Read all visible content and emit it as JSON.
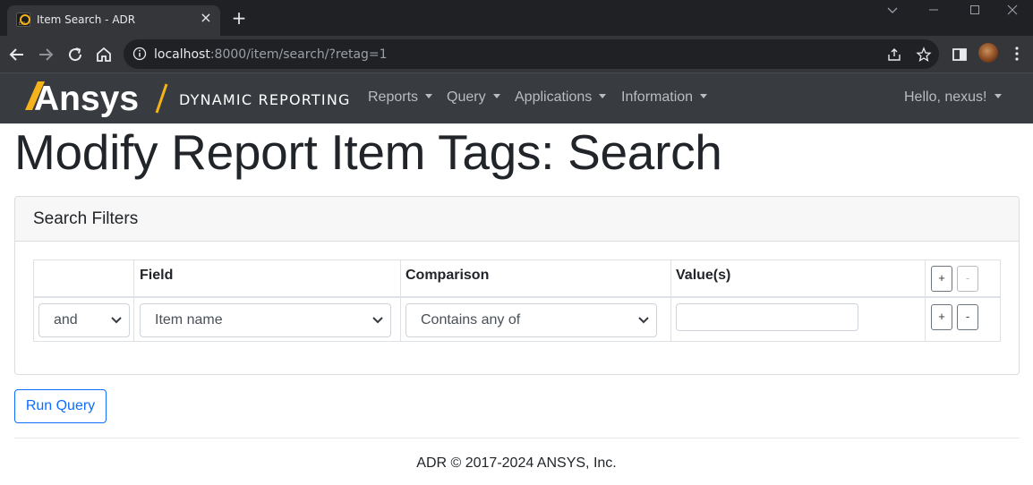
{
  "browser": {
    "tab_title": "Item Search - ADR",
    "favicon_text": "DR",
    "url_host": "localhost",
    "url_rest": ":8000/item/search/?retag=1"
  },
  "navbar": {
    "brand": "Ansys",
    "brand_subtitle": "DYNAMIC REPORTING",
    "brand_accent_color": "#f5b21b",
    "menus": [
      "Reports",
      "Query",
      "Applications",
      "Information"
    ],
    "user_greeting": "Hello, nexus!"
  },
  "page": {
    "title": "Modify Report Item Tags: Search"
  },
  "filters": {
    "card_title": "Search Filters",
    "columns": {
      "field": "Field",
      "comparison": "Comparison",
      "values": "Value(s)"
    },
    "add_label": "+",
    "remove_label": "-",
    "rows": [
      {
        "logic": "and",
        "field": "Item name",
        "comparison": "Contains any of",
        "value": ""
      }
    ]
  },
  "actions": {
    "run_query": "Run Query"
  },
  "footer": {
    "text": "ADR © 2017-2024 ANSYS, Inc."
  },
  "colors": {
    "navbar_bg": "#383b3f",
    "primary": "#0d6efd"
  }
}
